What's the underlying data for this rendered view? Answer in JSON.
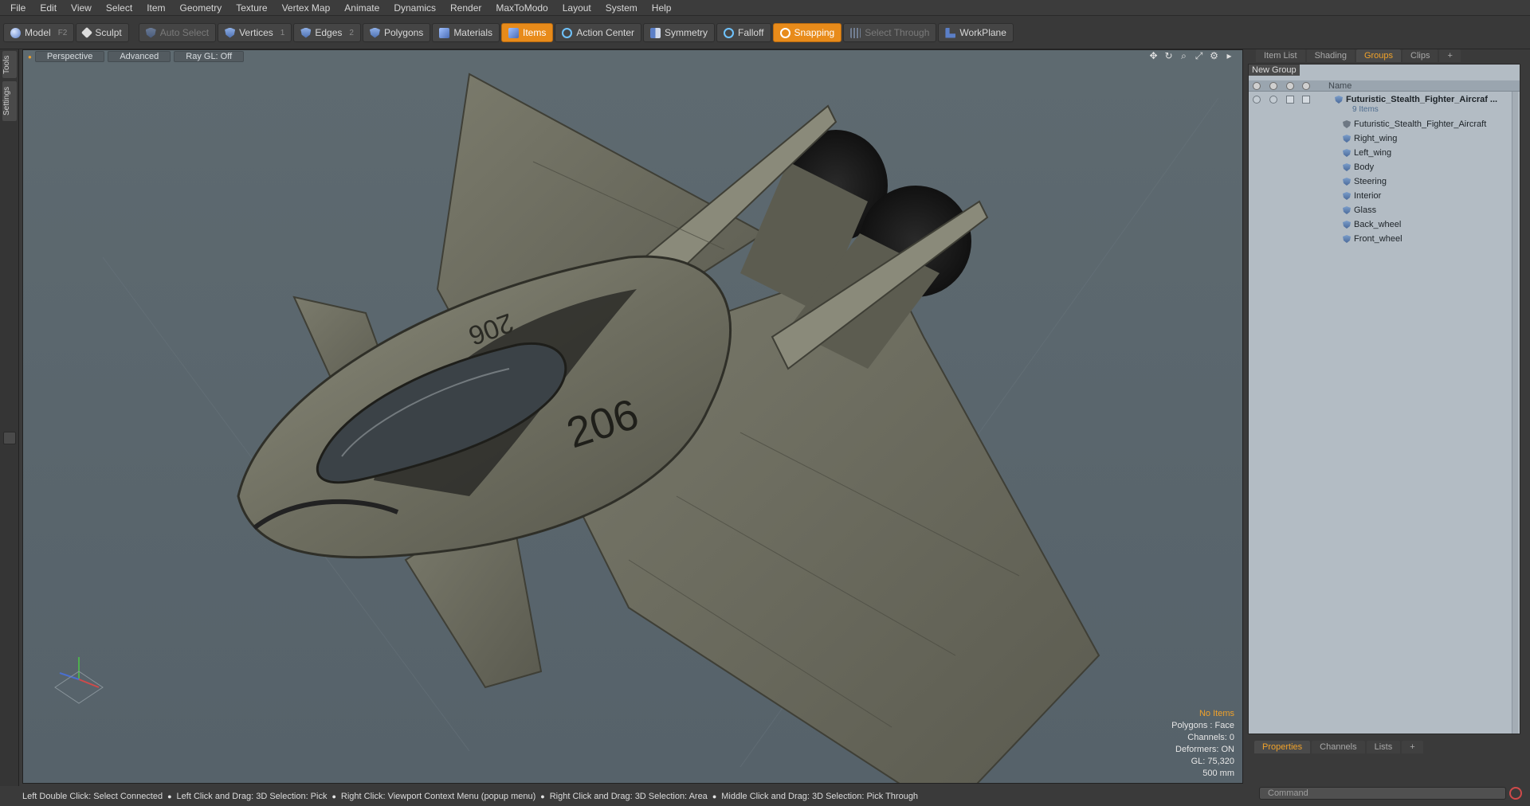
{
  "menu": [
    "File",
    "Edit",
    "View",
    "Select",
    "Item",
    "Geometry",
    "Texture",
    "Vertex Map",
    "Animate",
    "Dynamics",
    "Render",
    "MaxToModo",
    "Layout",
    "System",
    "Help"
  ],
  "toolbar": {
    "model": {
      "label": "Model",
      "shortcut": "F2",
      "icon": "model-sphere-icon"
    },
    "sculpt": {
      "label": "Sculpt",
      "icon": "brush-icon"
    },
    "auto_select": {
      "label": "Auto Select",
      "icon": "auto-select-icon"
    },
    "vertices": {
      "label": "Vertices",
      "shortcut": "1",
      "icon": "vertices-icon"
    },
    "edges": {
      "label": "Edges",
      "shortcut": "2",
      "icon": "edges-icon"
    },
    "polygons": {
      "label": "Polygons",
      "icon": "polygons-icon"
    },
    "materials": {
      "label": "Materials",
      "icon": "materials-icon"
    },
    "items": {
      "label": "Items",
      "icon": "items-icon"
    },
    "action_center": {
      "label": "Action Center",
      "icon": "action-center-icon"
    },
    "symmetry": {
      "label": "Symmetry",
      "icon": "symmetry-icon"
    },
    "falloff": {
      "label": "Falloff",
      "icon": "falloff-icon"
    },
    "snapping": {
      "label": "Snapping",
      "icon": "snapping-icon"
    },
    "select_through": {
      "label": "Select Through",
      "icon": "select-through-icon"
    },
    "workplane": {
      "label": "WorkPlane",
      "icon": "workplane-icon"
    }
  },
  "left_tabs": [
    "Tools",
    "Settings"
  ],
  "viewport": {
    "header": [
      "Perspective",
      "Advanced",
      "Ray GL: Off"
    ],
    "info": {
      "selection": "No Items",
      "polygons": "Polygons : Face",
      "channels": "Channels: 0",
      "deformers": "Deformers: ON",
      "gl": "GL: 75,320",
      "scale": "500 mm"
    },
    "aircraft_number": "206",
    "accent_color": "#f0a22a"
  },
  "right_panel": {
    "tabs": [
      "Item List",
      "Shading",
      "Groups",
      "Clips",
      "+"
    ],
    "active_tab": "Groups",
    "new_group": "New Group",
    "name_column": "Name",
    "group_name": "Futuristic_Stealth_Fighter_Aircraf ...",
    "group_count": "9 Items",
    "items": [
      "Futuristic_Stealth_Fighter_Aircraft",
      "Right_wing",
      "Left_wing",
      "Body",
      "Steering",
      "Interior",
      "Glass",
      "Back_wheel",
      "Front_wheel"
    ],
    "bottom_tabs": [
      "Properties",
      "Channels",
      "Lists",
      "+"
    ],
    "command_placeholder": "Command"
  },
  "status": [
    "Left Double Click: Select Connected",
    "Left Click and Drag: 3D Selection: Pick",
    "Right Click: Viewport Context Menu (popup menu)",
    "Right Click and Drag: 3D Selection: Area",
    "Middle Click and Drag: 3D Selection: Pick Through"
  ]
}
